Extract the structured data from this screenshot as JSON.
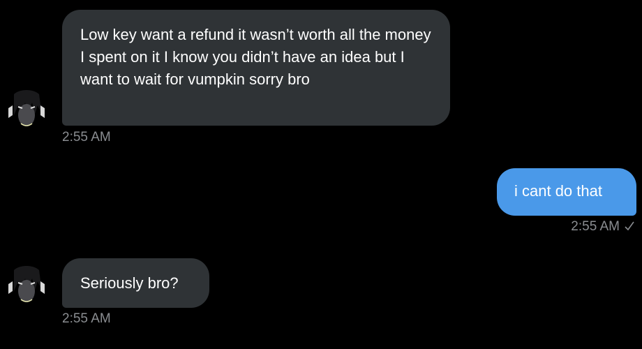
{
  "messages": [
    {
      "direction": "incoming",
      "text": "Low key want a refund it wasn’t worth all the money I spent on it I know you didn’t have an idea but I want to wait for vumpkin sorry bro",
      "time": "2:55 AM"
    },
    {
      "direction": "outgoing",
      "text": "i cant do that",
      "time": "2:55 AM",
      "status_icon": "checkmark-icon"
    },
    {
      "direction": "incoming",
      "text": "Seriously bro?",
      "time": "2:55 AM"
    }
  ],
  "colors": {
    "background": "#000000",
    "incoming_bubble": "#2f3336",
    "outgoing_bubble": "#4a99e9",
    "timestamp": "#8a8d91"
  }
}
